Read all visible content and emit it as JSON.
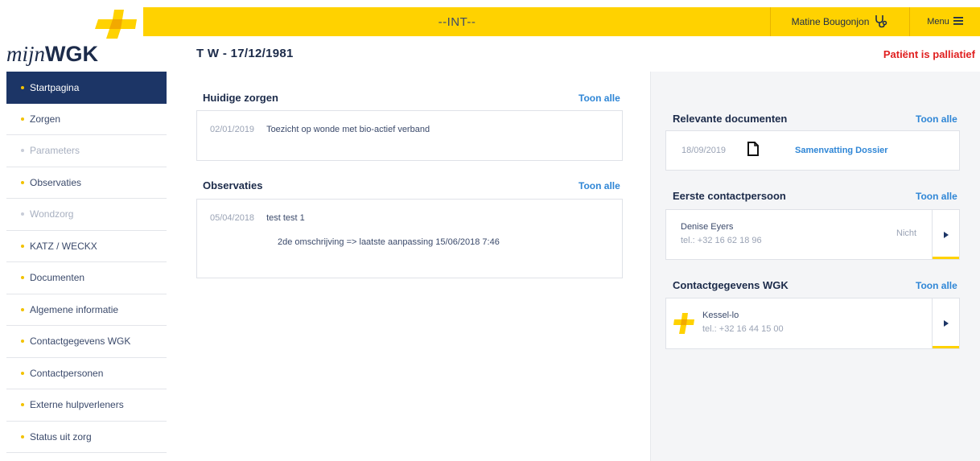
{
  "header": {
    "environment": "--INT--",
    "user_name": "Matine Bougonjon",
    "menu_label": "Menu"
  },
  "logo": {
    "part1": "mijn",
    "part2": "WGK"
  },
  "patient": {
    "title": "T W - 17/12/1981",
    "status": "Patiënt is palliatief"
  },
  "sidebar": {
    "items": [
      {
        "label": "Startpagina",
        "state": "active"
      },
      {
        "label": "Zorgen",
        "state": "normal"
      },
      {
        "label": "Parameters",
        "state": "disabled"
      },
      {
        "label": "Observaties",
        "state": "normal"
      },
      {
        "label": "Wondzorg",
        "state": "disabled"
      },
      {
        "label": "KATZ / WECKX",
        "state": "normal"
      },
      {
        "label": "Documenten",
        "state": "normal"
      },
      {
        "label": "Algemene informatie",
        "state": "normal"
      },
      {
        "label": "Contactgegevens WGK",
        "state": "normal"
      },
      {
        "label": "Contactpersonen",
        "state": "normal"
      },
      {
        "label": "Externe hulpverleners",
        "state": "normal"
      },
      {
        "label": "Status uit zorg",
        "state": "normal"
      }
    ]
  },
  "toon_alle": "Toon alle",
  "huidige_zorgen": {
    "title": "Huidige zorgen",
    "items": [
      {
        "date": "02/01/2019",
        "text": "Toezicht op wonde met bio-actief verband"
      }
    ]
  },
  "observaties": {
    "title": "Observaties",
    "items": [
      {
        "date": "05/04/2018",
        "text": "test test 1",
        "detail": "2de omschrijving => laatste aanpassing 15/06/2018 7:46"
      }
    ]
  },
  "documenten": {
    "title": "Relevante documenten",
    "items": [
      {
        "date": "18/09/2019",
        "icon": "document-icon",
        "name": "Samenvatting Dossier"
      }
    ]
  },
  "eerste_contact": {
    "title": "Eerste contactpersoon",
    "name": "Denise Eyers",
    "phone": "tel.: +32 16 62 18 96",
    "relation": "Nicht"
  },
  "contact_wgk": {
    "title": "Contactgegevens WGK",
    "name": "Kessel-lo",
    "phone": "tel.: +32 16 44 15 00"
  },
  "colors": {
    "brand_yellow": "#ffd200",
    "navy": "#1c3566",
    "link_blue": "#2f86d6",
    "alert_red": "#e02020"
  }
}
